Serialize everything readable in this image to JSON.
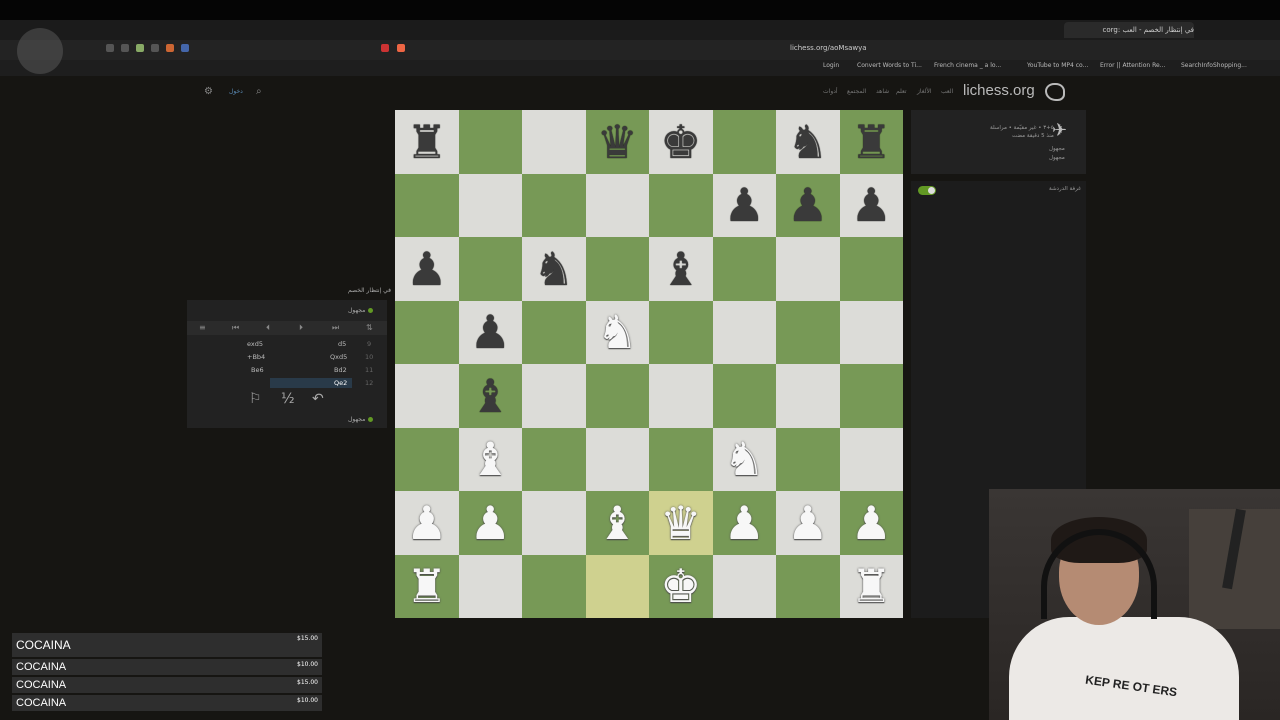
{
  "browser": {
    "tab_title": "في إنتظار الخصم - العب :corg",
    "url": "lichess.org/aoMsawya",
    "bookmarks": [
      "Login",
      "Convert Words to Ti...",
      "French cinema _ a lo...",
      "YouTube to MP4 co...",
      "Error || Attention Re...",
      "SearchInfoShopping..."
    ]
  },
  "header": {
    "logo": "lichess.org",
    "nav": [
      "العب",
      "الألغاز",
      "تعلم",
      "شاهد",
      "المجتمع",
      "أدوات"
    ],
    "login_label": "دخول"
  },
  "board": {
    "ranks": [
      [
        "bR",
        "",
        "",
        "bQ",
        "bK",
        "",
        "bN",
        "bR"
      ],
      [
        "",
        "",
        "",
        "",
        "",
        "bP",
        "bP",
        "bP"
      ],
      [
        "bP",
        "",
        "bN",
        "",
        "bB",
        "",
        "",
        ""
      ],
      [
        "",
        "bP",
        "",
        "wN",
        "",
        "",
        "",
        ""
      ],
      [
        "",
        "bB",
        "",
        "",
        "",
        "",
        "",
        ""
      ],
      [
        "",
        "wB",
        "",
        "",
        "",
        "wN",
        "",
        ""
      ],
      [
        "wP",
        "wP",
        "",
        "wB",
        "wQ",
        "wP",
        "wP",
        "wP"
      ],
      [
        "wR",
        "",
        "",
        "",
        "wK",
        "",
        "",
        "wR"
      ]
    ],
    "highlight": [
      "e2",
      "d1"
    ]
  },
  "moves_panel": {
    "title": "في إنتظار الخصم",
    "top_player": "مجهول",
    "bottom_player": "مجهول",
    "moves": [
      {
        "num": "9",
        "white": "d5",
        "black": "exd5"
      },
      {
        "num": "10",
        "white": "Qxd5",
        "black": "+Bb4"
      },
      {
        "num": "11",
        "white": "Bd2",
        "black": "Be6"
      },
      {
        "num": "12",
        "white": "Qe2",
        "black": ""
      }
    ],
    "draw_label": "½"
  },
  "right_panel": {
    "line1": "٥+٣ • غير مقيّمة • مراسلة",
    "line2": "منذ 5 دقيقة مضت",
    "player1": "مجهول",
    "player2": "مجهول",
    "chat_label": "غرفة الدردشة"
  },
  "donations": [
    {
      "name": "COCAINA",
      "amount": "$15.00"
    },
    {
      "name": "COCAINA",
      "amount": "$10.00"
    },
    {
      "name": "COCAINA",
      "amount": "$15.00"
    },
    {
      "name": "COCAINA",
      "amount": "$10.00"
    }
  ],
  "webcam": {
    "shirt_text": "KEP RE OT ERS"
  }
}
